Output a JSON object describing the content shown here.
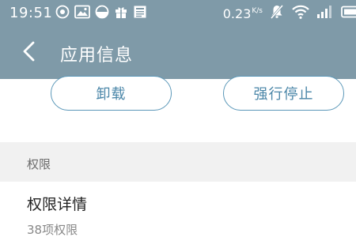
{
  "status_bar": {
    "time": "19:51",
    "left_icons": [
      "record-icon",
      "image-icon",
      "half-circle-icon",
      "gift-icon",
      "news-icon"
    ],
    "net_speed": "0.23",
    "net_speed_unit": "K/s",
    "right_icons": [
      "mute-icon",
      "wifi-icon",
      "signal-icon",
      "battery-icon"
    ]
  },
  "header": {
    "back_icon": "back-arrow-icon",
    "title": "应用信息"
  },
  "actions": {
    "uninstall_label": "卸载",
    "force_stop_label": "强行停止"
  },
  "permissions_section": {
    "header": "权限",
    "item_title": "权限详情",
    "item_subtitle": "38项权限"
  },
  "colors": {
    "header_bg": "#7f9aa8",
    "accent": "#4a86a8",
    "section_bg": "#f1f1f1"
  }
}
